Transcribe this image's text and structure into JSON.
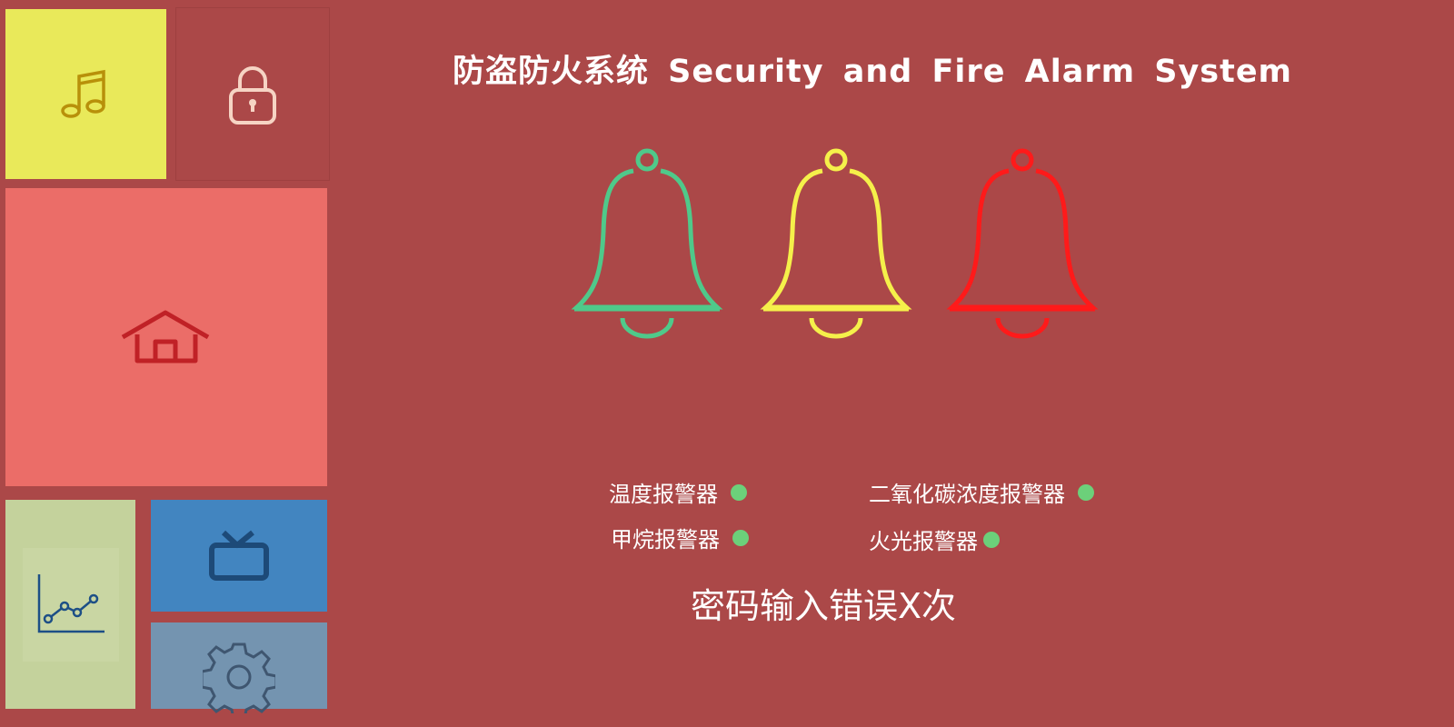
{
  "title": "防盗防火系统 Security  and Fire  Alarm System",
  "tiles": [
    {
      "name": "music",
      "icon": "music-note-icon",
      "color": "#e9e95a"
    },
    {
      "name": "lock",
      "icon": "lock-icon",
      "color": "#ab4848"
    },
    {
      "name": "home",
      "icon": "home-icon",
      "color": "#eb6d68"
    },
    {
      "name": "chart",
      "icon": "line-chart-icon",
      "color": "#c4d29c"
    },
    {
      "name": "tv",
      "icon": "tv-icon",
      "color": "#4285c0"
    },
    {
      "name": "settings",
      "icon": "gear-icon",
      "color": "#7494b0"
    }
  ],
  "bells": [
    {
      "color": "#4fc98a"
    },
    {
      "color": "#f5f04a"
    },
    {
      "color": "#ff1a1a"
    }
  ],
  "alarms": [
    {
      "label": "温度报警器",
      "status_color": "#6cd07a"
    },
    {
      "label": "二氧化碳浓度报警器",
      "status_color": "#6cd07a"
    },
    {
      "label": "甲烷报警器",
      "status_color": "#6cd07a"
    },
    {
      "label": "火光报警器",
      "status_color": "#6cd07a"
    }
  ],
  "password_error": "密码输入错误X次"
}
